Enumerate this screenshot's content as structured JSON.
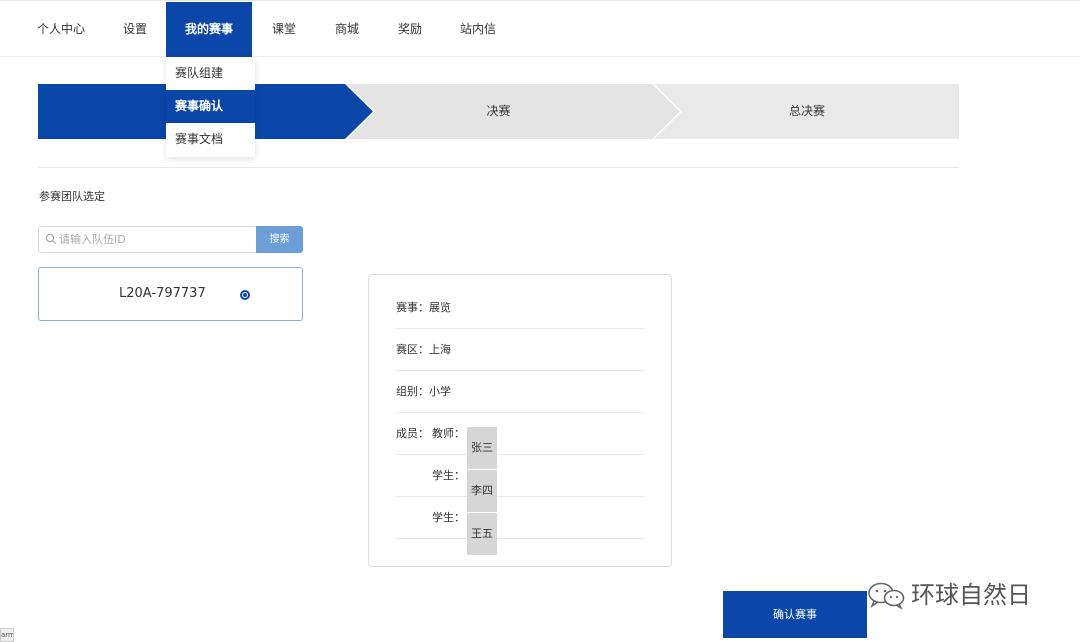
{
  "nav": {
    "items": [
      {
        "label": "个人中心"
      },
      {
        "label": "设置"
      },
      {
        "label": "我的赛事"
      },
      {
        "label": "课堂"
      },
      {
        "label": "商城"
      },
      {
        "label": "奖励"
      },
      {
        "label": "站内信"
      }
    ],
    "active": "我的赛事"
  },
  "dropdown": {
    "items": [
      {
        "label": "赛队组建"
      },
      {
        "label": "赛事确认"
      },
      {
        "label": "赛事文档"
      }
    ],
    "active": "赛事确认"
  },
  "steps": {
    "items": [
      {
        "label": ""
      },
      {
        "label": "决赛"
      },
      {
        "label": "总决赛"
      }
    ]
  },
  "section_title": "参赛团队选定",
  "search": {
    "placeholder": "请输入队伍ID",
    "value": "",
    "button_label": "搜索"
  },
  "team": {
    "id": "L20A-797737",
    "selected": true
  },
  "info": {
    "event_label": "赛事：",
    "event_value": "展览",
    "region_label": "赛区：",
    "region_value": "上海",
    "group_label": "组别：",
    "group_value": "小学",
    "members_label": "成员：",
    "members": [
      {
        "role": "教师：",
        "name": "张三"
      },
      {
        "role": "学生：",
        "name": "李四"
      },
      {
        "role": "学生：",
        "name": "王五"
      }
    ]
  },
  "confirm_label": "确认赛事",
  "watermark": {
    "text": "环球自然日",
    "icon": "wechat-icon"
  },
  "corner_tag": "arm",
  "colors": {
    "primary": "#0a47a8",
    "search_button": "#6c9fd8",
    "step_inactive": "#e4e4e4"
  }
}
